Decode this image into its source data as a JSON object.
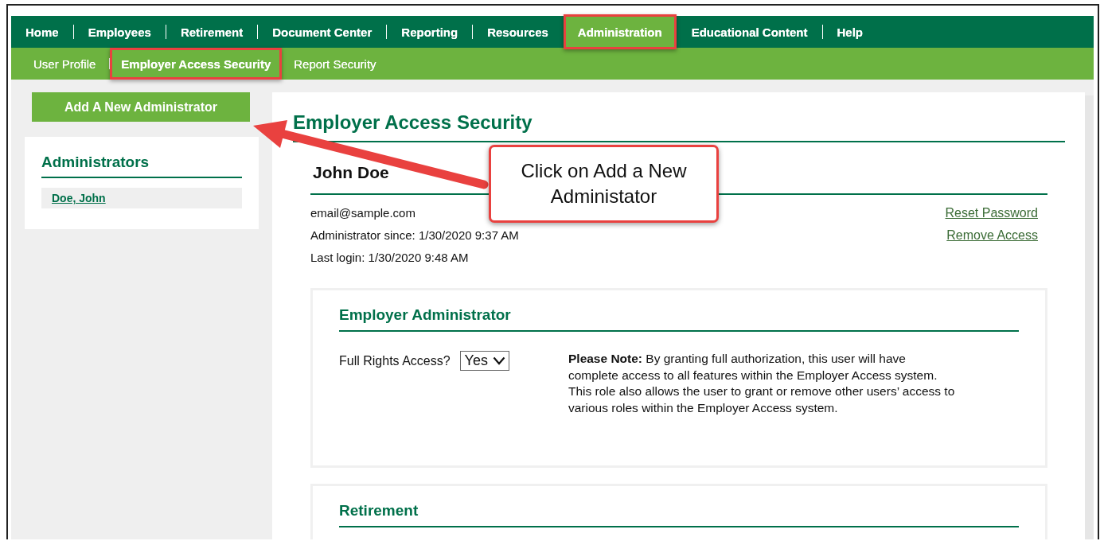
{
  "main_nav": [
    {
      "label": "Home",
      "selected": false,
      "highlighted": false,
      "divider_after": true
    },
    {
      "label": "Employees",
      "selected": false,
      "highlighted": false,
      "divider_after": true
    },
    {
      "label": "Retirement",
      "selected": false,
      "highlighted": false,
      "divider_after": true
    },
    {
      "label": "Document Center",
      "selected": false,
      "highlighted": false,
      "divider_after": true
    },
    {
      "label": "Reporting",
      "selected": false,
      "highlighted": false,
      "divider_after": true
    },
    {
      "label": "Resources",
      "selected": false,
      "highlighted": false,
      "divider_after": false
    },
    {
      "label": "Administration",
      "selected": true,
      "highlighted": true,
      "divider_after": false
    },
    {
      "label": "Educational Content",
      "selected": false,
      "highlighted": false,
      "divider_after": true
    },
    {
      "label": "Help",
      "selected": false,
      "highlighted": false,
      "divider_after": false
    }
  ],
  "sub_nav": [
    {
      "label": "User Profile",
      "selected": false,
      "highlighted": false,
      "divider_after": true
    },
    {
      "label": "Employer Access Security",
      "selected": true,
      "highlighted": true,
      "divider_after": false
    },
    {
      "label": "Report Security",
      "selected": false,
      "highlighted": false,
      "divider_after": false
    }
  ],
  "sidebar": {
    "add_button": "Add A New Administrator",
    "title": "Administrators",
    "items": [
      {
        "label": "Doe, John",
        "selected": true
      }
    ]
  },
  "main": {
    "title": "Employer Access Security",
    "user": {
      "name": "John Doe",
      "email": "email@sample.com",
      "since": "Administrator since: 1/30/2020 9:37 AM",
      "last_login": "Last login: 1/30/2020 9:48 AM"
    },
    "links": [
      "Reset Password",
      "Remove Access"
    ],
    "sections": [
      {
        "title": "Employer Administrator",
        "field_label": "Full Rights Access?",
        "select_value": "Yes",
        "note": "**Please Note:** By granting full authorization, this user will have complete access to all features within the Employer Access system. This role also allows the user to grant or remove other users’ access to various roles within the Employer Access system."
      },
      {
        "title": "Retirement"
      }
    ]
  },
  "callout": {
    "text": "Click on Add a New Administator"
  }
}
